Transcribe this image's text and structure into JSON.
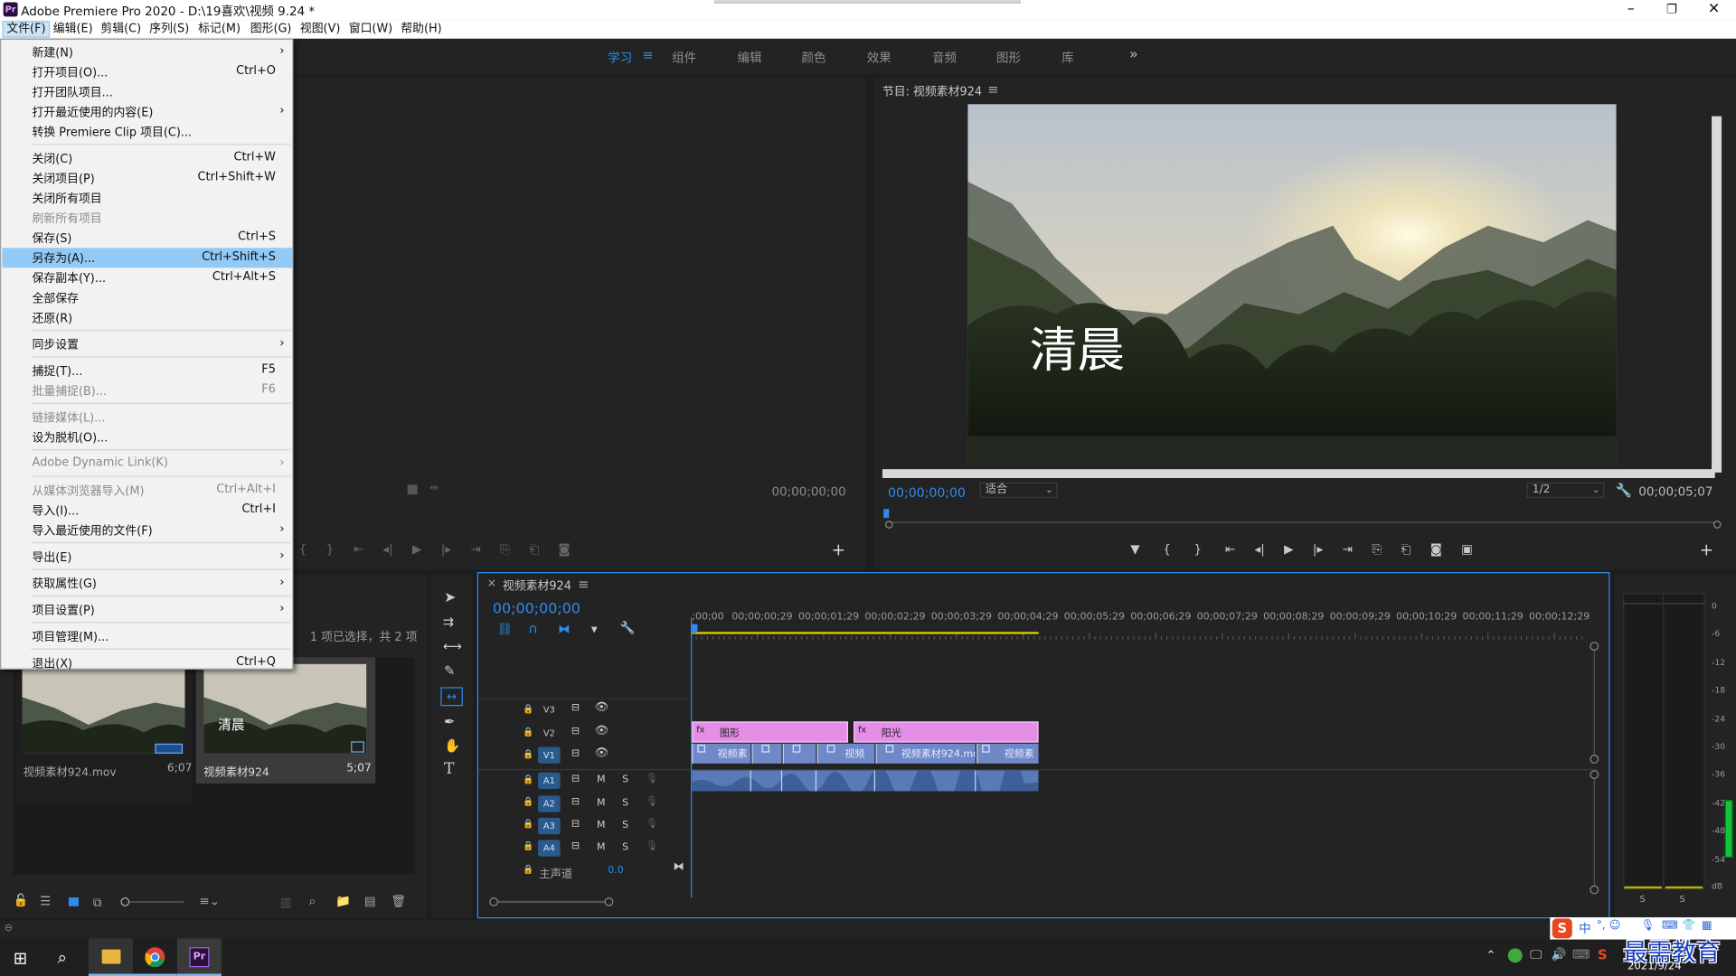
{
  "window": {
    "app_badge": "Pr",
    "title": "Adobe Premiere Pro 2020 - D:\\19喜欢\\视频 9.24 *",
    "minimize": "–",
    "maximize": "❐",
    "close": "✕"
  },
  "menubar": [
    "文件(F)",
    "编辑(E)",
    "剪辑(C)",
    "序列(S)",
    "标记(M)",
    "图形(G)",
    "视图(V)",
    "窗口(W)",
    "帮助(H)"
  ],
  "workspaces": {
    "tabs": [
      "学习",
      "组件",
      "编辑",
      "颜色",
      "效果",
      "音频",
      "图形",
      "库"
    ],
    "active": "学习",
    "overflow": "»"
  },
  "file_menu": [
    {
      "label": "新建(N)",
      "shortcut": "",
      "submenu": true,
      "disabled": false
    },
    {
      "label": "打开项目(O)...",
      "shortcut": "Ctrl+O",
      "submenu": false,
      "disabled": false
    },
    {
      "label": "打开团队项目...",
      "shortcut": "",
      "submenu": false,
      "disabled": false
    },
    {
      "label": "打开最近使用的内容(E)",
      "shortcut": "",
      "submenu": true,
      "disabled": false
    },
    {
      "label": "转换 Premiere Clip 项目(C)...",
      "shortcut": "",
      "submenu": false,
      "disabled": false
    },
    {
      "label": "关闭(C)",
      "shortcut": "Ctrl+W",
      "submenu": false,
      "disabled": false
    },
    {
      "label": "关闭项目(P)",
      "shortcut": "Ctrl+Shift+W",
      "submenu": false,
      "disabled": false
    },
    {
      "label": "关闭所有项目",
      "shortcut": "",
      "submenu": false,
      "disabled": false
    },
    {
      "label": "刷新所有项目",
      "shortcut": "",
      "submenu": false,
      "disabled": true
    },
    {
      "label": "保存(S)",
      "shortcut": "Ctrl+S",
      "submenu": false,
      "disabled": false
    },
    {
      "label": "另存为(A)...",
      "shortcut": "Ctrl+Shift+S",
      "submenu": false,
      "disabled": false,
      "highlighted": true
    },
    {
      "label": "保存副本(Y)...",
      "shortcut": "Ctrl+Alt+S",
      "submenu": false,
      "disabled": false
    },
    {
      "label": "全部保存",
      "shortcut": "",
      "submenu": false,
      "disabled": false
    },
    {
      "label": "还原(R)",
      "shortcut": "",
      "submenu": false,
      "disabled": false
    },
    {
      "label": "同步设置",
      "shortcut": "",
      "submenu": true,
      "disabled": false
    },
    {
      "label": "捕捉(T)...",
      "shortcut": "F5",
      "submenu": false,
      "disabled": false
    },
    {
      "label": "批量捕捉(B)...",
      "shortcut": "F6",
      "submenu": false,
      "disabled": true
    },
    {
      "label": "链接媒体(L)...",
      "shortcut": "",
      "submenu": false,
      "disabled": true
    },
    {
      "label": "设为脱机(O)...",
      "shortcut": "",
      "submenu": false,
      "disabled": false
    },
    {
      "label": "Adobe Dynamic Link(K)",
      "shortcut": "",
      "submenu": true,
      "disabled": true
    },
    {
      "label": "从媒体浏览器导入(M)",
      "shortcut": "Ctrl+Alt+I",
      "submenu": false,
      "disabled": true
    },
    {
      "label": "导入(I)...",
      "shortcut": "Ctrl+I",
      "submenu": false,
      "disabled": false
    },
    {
      "label": "导入最近使用的文件(F)",
      "shortcut": "",
      "submenu": true,
      "disabled": false
    },
    {
      "label": "导出(E)",
      "shortcut": "",
      "submenu": true,
      "disabled": false
    },
    {
      "label": "获取属性(G)",
      "shortcut": "",
      "submenu": true,
      "disabled": false
    },
    {
      "label": "项目设置(P)",
      "shortcut": "",
      "submenu": true,
      "disabled": false
    },
    {
      "label": "项目管理(M)...",
      "shortcut": "",
      "submenu": false,
      "disabled": false
    },
    {
      "label": "退出(X)",
      "shortcut": "Ctrl+Q",
      "submenu": false,
      "disabled": false
    }
  ],
  "source_monitor": {
    "timecode": "00;00;00;00"
  },
  "program_monitor": {
    "title": "节目: 视频素材924",
    "overlay_text": "清晨",
    "timecode": "00;00;00;00",
    "fit": "适合",
    "resolution": "1/2",
    "duration": "00;00;05;07"
  },
  "project_panel": {
    "selection_info": "1 项已选择，共 2 项",
    "items": [
      {
        "name": "视频素材924.mov",
        "duration": "6;07",
        "thumb_text": ""
      },
      {
        "name": "视频素材924",
        "duration": "5;07",
        "thumb_text": "清晨"
      }
    ]
  },
  "timeline": {
    "sequence_name": "视频素材924",
    "timecode": "00;00;00;00",
    "ruler": [
      ";00;00",
      "00;00;00;29",
      "00;00;01;29",
      "00;00;02;29",
      "00;00;03;29",
      "00;00;04;29",
      "00;00;05;29",
      "00;00;06;29",
      "00;00;07;29",
      "00;00;08;29",
      "00;00;09;29",
      "00;00;10;29",
      "00;00;11;29",
      "00;00;12;29"
    ],
    "video_tracks": [
      "V3",
      "V2",
      "V1"
    ],
    "audio_tracks": [
      "A1",
      "A2",
      "A3",
      "A4"
    ],
    "track_m": "M",
    "track_s": "S",
    "master": {
      "label": "主声道",
      "value": "0.0"
    },
    "graphic_clips": [
      "图形",
      "阳光"
    ],
    "video_clips": [
      "视频素",
      "",
      "",
      "视频",
      "视频素材924.mov",
      "视频素"
    ]
  },
  "audio_meter": {
    "scale": [
      "0",
      "-6",
      "-12",
      "-18",
      "-24",
      "-30",
      "-36",
      "-42",
      "-48",
      "-54",
      "dB"
    ],
    "solo": [
      "S",
      "S"
    ]
  },
  "taskbar": {
    "date": "2021/9/24",
    "ime_label": "中",
    "ime_extra": "°, ☺",
    "logo_text": "最需教育"
  },
  "colors": {
    "accent": "#2d8ceb",
    "graphic_clip": "#e58ee8",
    "video_clip": "#6e88c8",
    "audio_clip": "#5a79b8",
    "menu_highlight": "#91c9f7"
  }
}
